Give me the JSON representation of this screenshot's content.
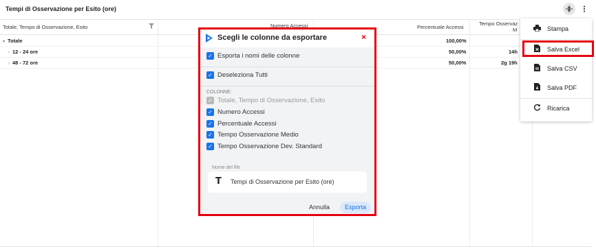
{
  "panel": {
    "title": "Tempi di Osservazione per Esito (ore)"
  },
  "grid": {
    "headers": {
      "col1": "Totale, Tempo di Osservazione, Esito",
      "col2": "Numero Accessi",
      "col3": "Percentuale Accessi",
      "col4_line1": "Tempo Osservaz",
      "col4_line2": "M"
    },
    "rows": [
      {
        "label": "Totale",
        "caret": "▾",
        "pct": "100,00%",
        "time": ""
      },
      {
        "label": "12 - 24 ore",
        "caret": "›",
        "pct": "50,00%",
        "time": "14h"
      },
      {
        "label": "48 - 72 ore",
        "caret": "›",
        "pct": "50,00%",
        "time": "2g 19h"
      }
    ]
  },
  "dialog": {
    "title": "Scegli le colonne da esportare",
    "close_icon": "×",
    "export_names_label": "Esporta i nomi delle colonne",
    "deselect_all_label": "Deseleziona Tutti",
    "columns_label": "COLONNE:",
    "columns": [
      {
        "label": "Totale, Tempo di Osservazione, Esito",
        "checked": true,
        "disabled": true
      },
      {
        "label": "Numero Accessi",
        "checked": true,
        "disabled": false
      },
      {
        "label": "Percentuale Accessi",
        "checked": true,
        "disabled": false
      },
      {
        "label": "Tempo Osservazione Medio",
        "checked": true,
        "disabled": false
      },
      {
        "label": "Tempo Osservazione Dev. Standard",
        "checked": true,
        "disabled": false
      }
    ],
    "file_name_label": "Nome del file",
    "file_name_value": "Tempi di Osservazione per Esito (ore)",
    "text_icon": "T",
    "cancel_label": "Annulla",
    "export_label": "Esporta"
  },
  "menu": {
    "items": [
      {
        "label": "Stampa",
        "icon": "print-icon"
      },
      {
        "label": "Salva Excel",
        "icon": "excel-file-icon"
      },
      {
        "label": "Salva CSV",
        "icon": "csv-file-icon"
      },
      {
        "label": "Salva PDF",
        "icon": "pdf-file-icon"
      },
      {
        "label": "Ricarica",
        "icon": "refresh-icon"
      }
    ]
  },
  "colors": {
    "highlight": "#e5000e",
    "accent": "#1a73e8"
  }
}
